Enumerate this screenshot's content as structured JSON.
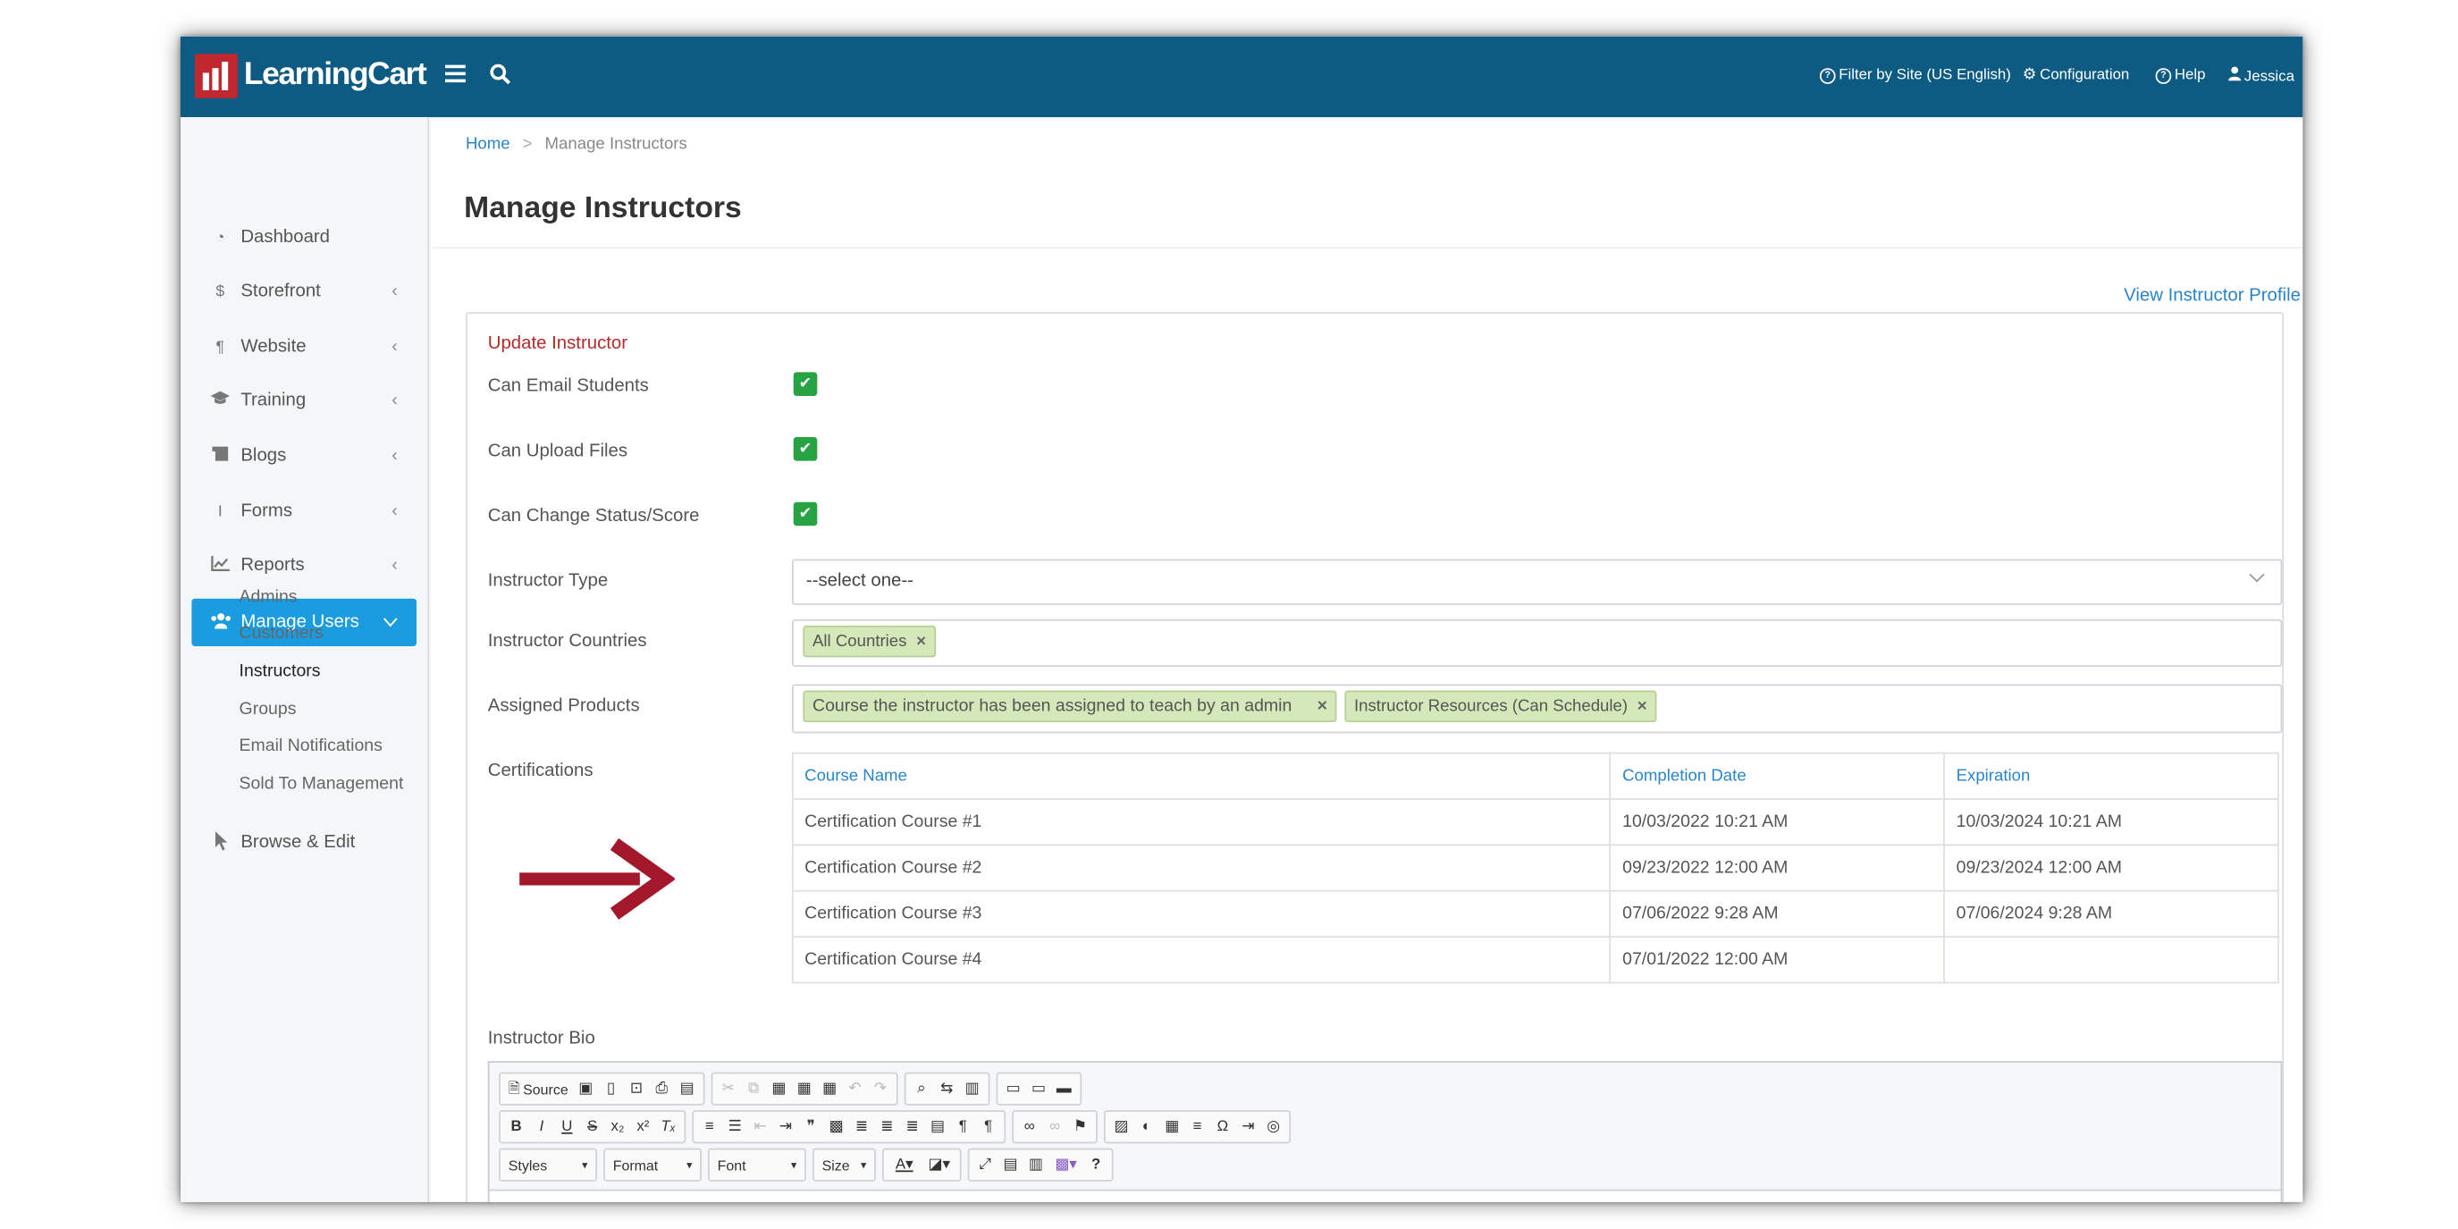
{
  "header": {
    "brand": "LearningCart",
    "filter_label": "Filter by Site (US English)",
    "config_label": "Configuration",
    "help_label": "Help",
    "user_label": "Jessica"
  },
  "sidebar": {
    "items": [
      {
        "label": "Dashboard",
        "icon": "dashboard-icon"
      },
      {
        "label": "Storefront",
        "icon": "dollar-icon"
      },
      {
        "label": "Website",
        "icon": "paragraph-icon"
      },
      {
        "label": "Training",
        "icon": "graduation-cap-icon"
      },
      {
        "label": "Blogs",
        "icon": "scroll-icon"
      },
      {
        "label": "Forms",
        "icon": "text-cursor-icon"
      },
      {
        "label": "Reports",
        "icon": "line-chart-icon"
      },
      {
        "label": "Manage Users",
        "icon": "users-icon"
      },
      {
        "label": "Browse & Edit",
        "icon": "pointer-icon"
      }
    ],
    "sub_items": [
      "Admins",
      "Customers",
      "Instructors",
      "Groups",
      "Email Notifications",
      "Sold To Management"
    ]
  },
  "breadcrumb": {
    "home": "Home",
    "separator": ">",
    "current": "Manage Instructors"
  },
  "page_title": "Manage Instructors",
  "view_profile_link": "View Instructor Profile",
  "form": {
    "title": "Update Instructor",
    "can_email_label": "Can Email Students",
    "can_email": true,
    "can_upload_label": "Can Upload Files",
    "can_upload": true,
    "can_change_label": "Can Change Status/Score",
    "can_change": true,
    "instructor_type_label": "Instructor Type",
    "instructor_type_value": "--select one--",
    "countries_label": "Instructor Countries",
    "countries_tags": [
      "All Countries"
    ],
    "products_label": "Assigned Products",
    "products_tags": [
      "Course the instructor has been assigned to teach by an admin",
      "Instructor Resources (Can Schedule)"
    ],
    "certs_label": "Certifications",
    "bio_label": "Instructor Bio"
  },
  "certifications": {
    "columns": [
      "Course Name",
      "Completion Date",
      "Expiration"
    ],
    "rows": [
      [
        "Certification Course #1",
        "10/03/2022 10:21 AM",
        "10/03/2024 10:21 AM"
      ],
      [
        "Certification Course #2",
        "09/23/2022 12:00 AM",
        "09/23/2024 12:00 AM"
      ],
      [
        "Certification Course #3",
        "07/06/2022 9:28 AM",
        "07/06/2024 9:28 AM"
      ],
      [
        "Certification Course #4",
        "07/01/2022 12:00 AM",
        ""
      ]
    ]
  },
  "editor": {
    "source_label": "Source",
    "styles_label": "Styles",
    "format_label": "Format",
    "font_label": "Font",
    "size_label": "Size"
  },
  "colors": {
    "header_bg": "#0d5b82",
    "brand_red": "#c0282d",
    "active_nav": "#1b9ce0",
    "checkbox_green": "#27a344",
    "annotation_arrow": "#a3182a"
  }
}
